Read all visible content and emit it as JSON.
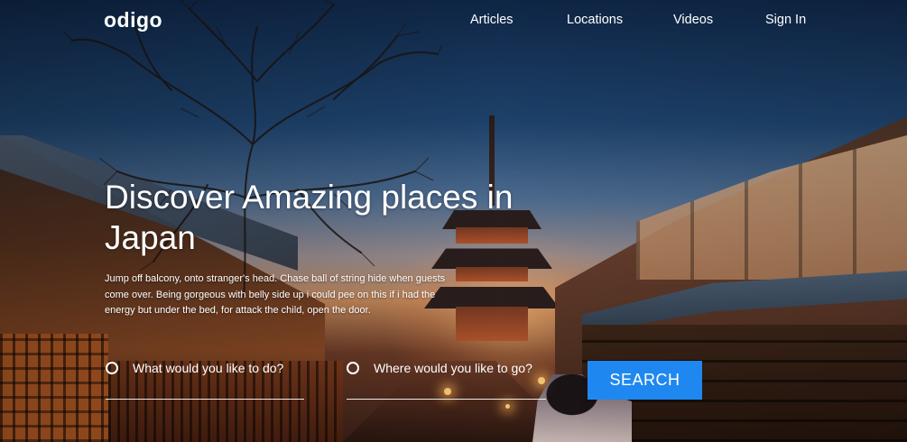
{
  "brand": {
    "logo": "odigo"
  },
  "nav": {
    "items": [
      {
        "label": "Articles"
      },
      {
        "label": "Locations"
      },
      {
        "label": "Videos"
      },
      {
        "label": "Sign In"
      }
    ]
  },
  "hero": {
    "headline": "Discover Amazing places in Japan",
    "description": "Jump off balcony, onto stranger's head. Chase ball of string hide when guests come over. Being gorgeous with belly side up i could pee on this if i had the energy but under the bed, for attack the child, open the door."
  },
  "search": {
    "activity_placeholder": "What would you like to do?",
    "location_placeholder": "Where would you like to go?",
    "button_label": "SEARCH",
    "button_color": "#1f88f0"
  }
}
